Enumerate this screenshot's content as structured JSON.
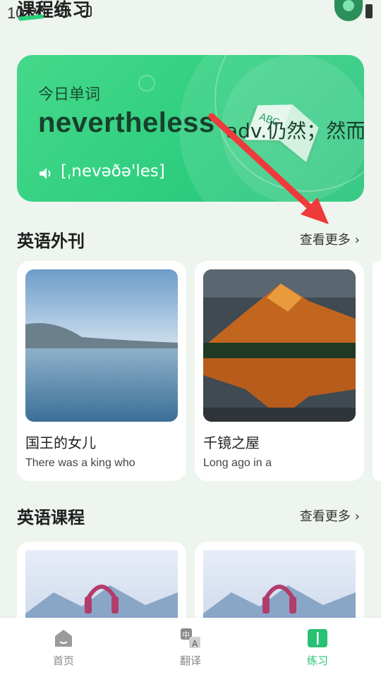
{
  "status_bar": {
    "time": "10:20"
  },
  "page": {
    "title": "课程练习"
  },
  "banner": {
    "label": "今日单词",
    "word": "nevertheless",
    "meaning": "adv.仍然；然而",
    "phonetic": "[ˌnevəðə'les]",
    "book_letters": "ABC"
  },
  "sections": {
    "magazine": {
      "title": "英语外刊",
      "more": "查看更多",
      "cards": [
        {
          "title": "国王的女儿",
          "subtitle": "There was a king who"
        },
        {
          "title": "千镜之屋",
          "subtitle": "Long ago in a"
        }
      ]
    },
    "courses": {
      "title": "英语课程",
      "more": "查看更多"
    }
  },
  "bottom_nav": {
    "items": [
      {
        "label": "首页",
        "icon": "home-icon",
        "active": false
      },
      {
        "label": "翻译",
        "icon": "translate-icon",
        "active": false,
        "icon_text_a": "中",
        "icon_text_b": "A"
      },
      {
        "label": "练习",
        "icon": "book-icon",
        "active": true
      }
    ]
  },
  "colors": {
    "accent": "#27c173",
    "banner": "#2fce7f",
    "background": "#eef4ee"
  }
}
